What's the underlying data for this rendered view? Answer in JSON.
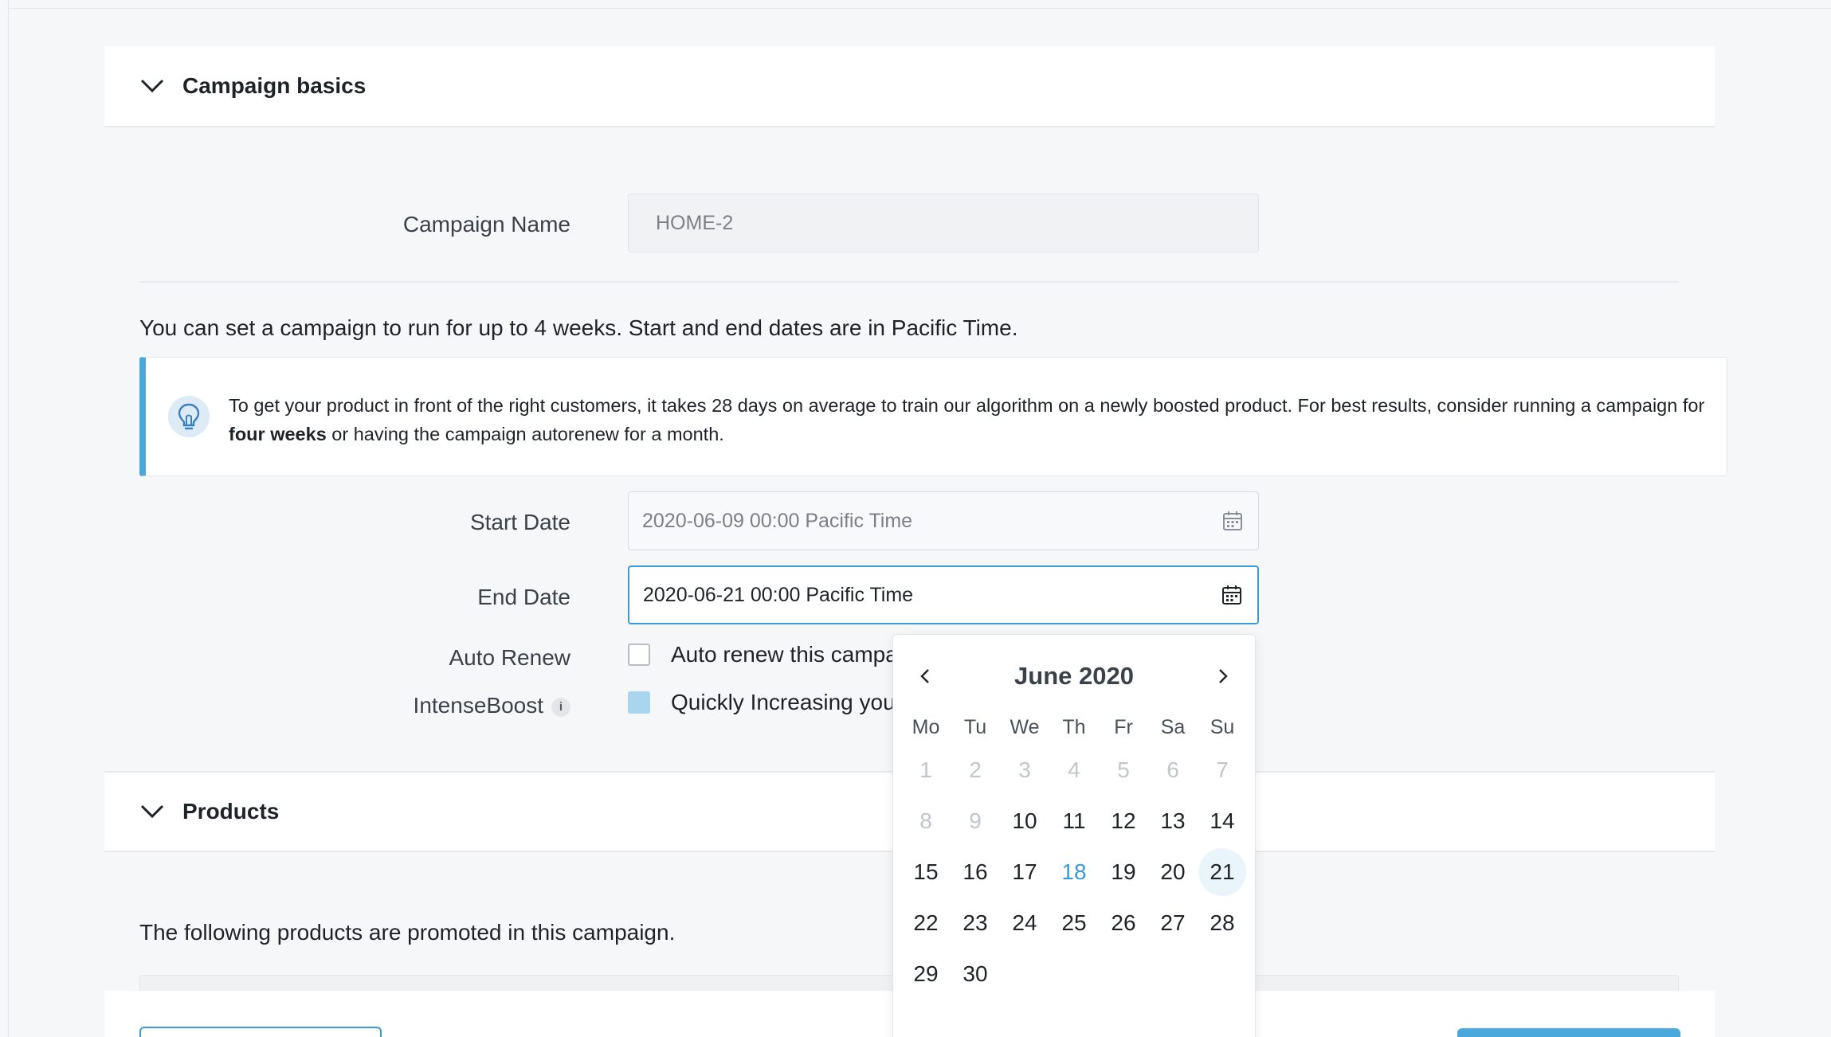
{
  "basics": {
    "title": "Campaign basics",
    "campaign_name_label": "Campaign Name",
    "campaign_name_value": "HOME-2",
    "intro": "You can set a campaign to run for up to 4 weeks. Start and end dates are in Pacific Time.",
    "tip_part1": "To get your product in front of the right customers, it takes 28 days on average to train our algorithm on a newly boosted product. For best results, consider running a campaign for ",
    "tip_bold": "four weeks",
    "tip_part2": " or having the campaign autorenew for a month.",
    "start_label": "Start Date",
    "start_value": "2020-06-09 00:00 Pacific Time",
    "end_label": "End Date",
    "end_value": "2020-06-21 00:00 Pacific Time",
    "auto_renew_label": "Auto Renew",
    "auto_renew_text": "Auto renew this campa",
    "intense_label": "IntenseBoost",
    "intense_info": "i",
    "intense_text": "Quickly Increasing you"
  },
  "calendar": {
    "month": "June 2020",
    "weekdays": [
      "Mo",
      "Tu",
      "We",
      "Th",
      "Fr",
      "Sa",
      "Su"
    ],
    "days": [
      "1",
      "2",
      "3",
      "4",
      "5",
      "6",
      "7",
      "8",
      "9",
      "10",
      "11",
      "12",
      "13",
      "14",
      "15",
      "16",
      "17",
      "18",
      "19",
      "20",
      "21",
      "22",
      "23",
      "24",
      "25",
      "26",
      "27",
      "28",
      "29",
      "30"
    ],
    "disabled_through": 9,
    "today": 18,
    "selected": 21
  },
  "products": {
    "title": "Products",
    "text": "The following products are promoted in this campaign."
  },
  "colors": {
    "accent": "#3a9ad9",
    "tip_border": "#4aa8dc"
  }
}
